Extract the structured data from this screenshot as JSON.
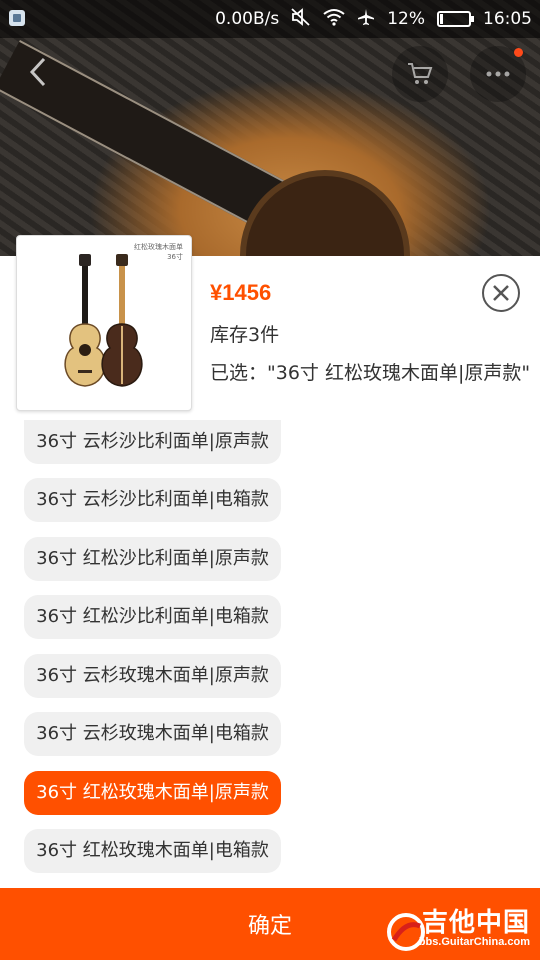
{
  "status_bar": {
    "net_speed": "0.00B/s",
    "battery_percent": "12%",
    "battery_level": 0.12,
    "time": "16:05",
    "icons": [
      "notification-icon",
      "mute-icon",
      "wifi-icon",
      "airplane-icon",
      "battery-icon"
    ]
  },
  "top_actions": {
    "back_icon": "chevron-left-icon",
    "cart_icon": "cart-icon",
    "more_icon": "more-dots-icon"
  },
  "product": {
    "thumbnail_caption_line1": "红松玫瑰木面单",
    "thumbnail_caption_line2": "36寸",
    "price": "¥1456",
    "stock": "库存3件",
    "selected": "已选：\"36寸 红松玫瑰木面单|原声款\""
  },
  "options": [
    {
      "label": "36寸 云杉沙比利面单|原声款",
      "active": false
    },
    {
      "label": "36寸 云杉沙比利面单|电箱款",
      "active": false
    },
    {
      "label": "36寸 红松沙比利面单|原声款",
      "active": false
    },
    {
      "label": "36寸 红松沙比利面单|电箱款",
      "active": false
    },
    {
      "label": "36寸 云杉玫瑰木面单|原声款",
      "active": false
    },
    {
      "label": "36寸 云杉玫瑰木面单|电箱款",
      "active": false
    },
    {
      "label": "36寸 红松玫瑰木面单|原声款",
      "active": true
    },
    {
      "label": "36寸 红松玫瑰木面单|电箱款",
      "active": false
    }
  ],
  "confirm_label": "确定",
  "watermark": {
    "title": "吉他中国",
    "url": "bbs.GuitarChina.com"
  },
  "colors": {
    "accent": "#ff5000",
    "option_bg": "#f0f0f0"
  }
}
